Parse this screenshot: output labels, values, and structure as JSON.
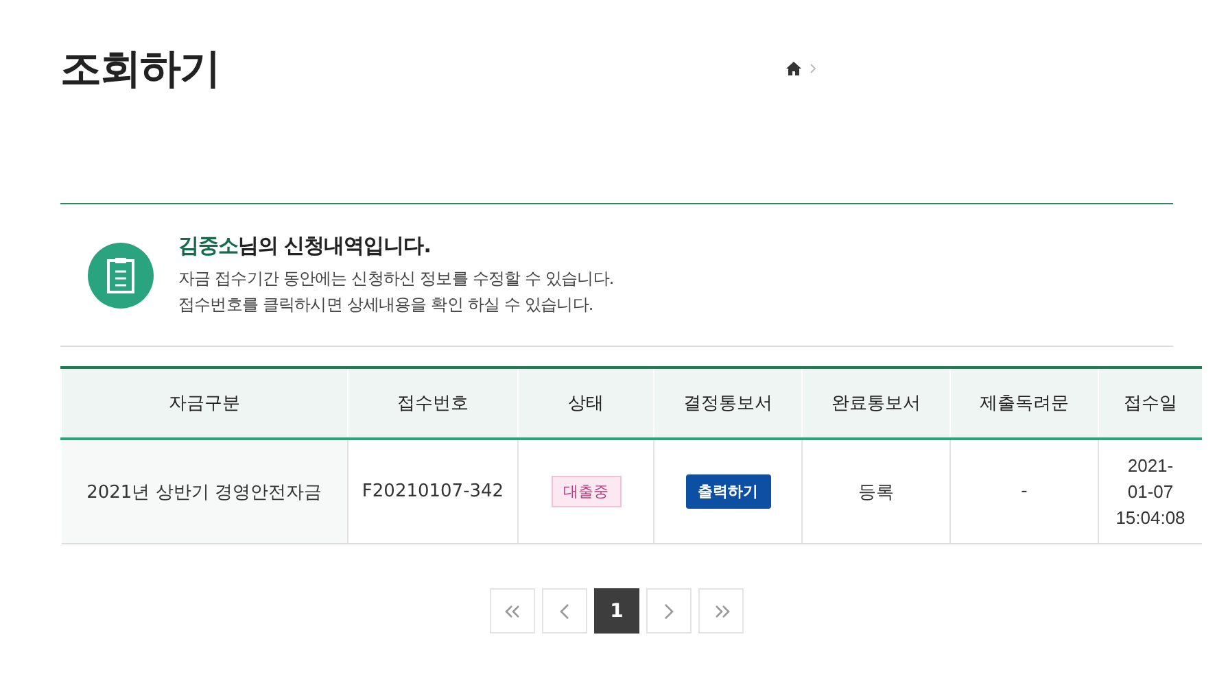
{
  "page_title": "조회하기",
  "notice": {
    "name": "김중소",
    "heading_rest": "님의 신청내역입니다.",
    "lines": [
      "자금 접수기간 동안에는 신청하신 정보를 수정할 수 있습니다.",
      "접수번호를 클릭하시면 상세내용을 확인 하실 수 있습니다."
    ]
  },
  "table": {
    "columns": [
      "자금구분",
      "접수번호",
      "상태",
      "결정통보서",
      "완료통보서",
      "제출독려문",
      "접수일"
    ],
    "rows": [
      {
        "cells": [
          {
            "kind": "text",
            "text": "2021년 상반기 경영안전자금"
          },
          {
            "kind": "text",
            "text": "F20210107-342"
          },
          {
            "kind": "badge",
            "text": "대출중"
          },
          {
            "kind": "button",
            "text": "출력하기"
          },
          {
            "kind": "text",
            "text": "등록"
          },
          {
            "kind": "text",
            "text": "-"
          },
          {
            "kind": "text",
            "text": "2021-01-07 15:04:08"
          }
        ]
      }
    ]
  },
  "pagination": {
    "pages": [
      {
        "label": "1",
        "selected": true
      }
    ]
  }
}
